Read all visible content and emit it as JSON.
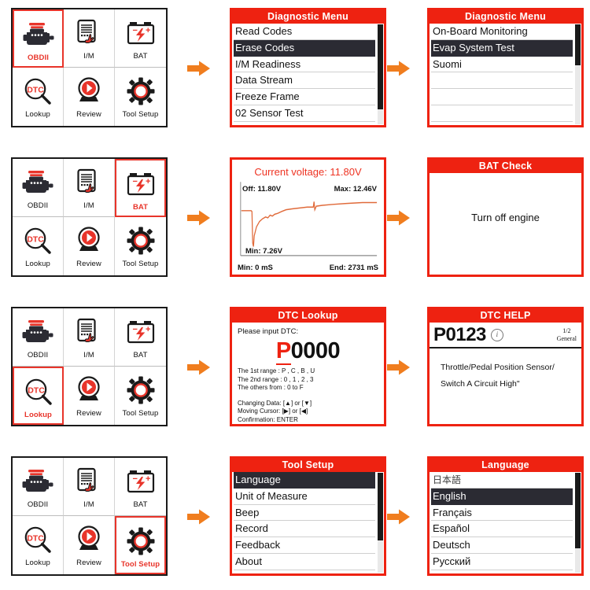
{
  "menu": {
    "items": [
      {
        "label": "OBDII",
        "icon": "engine-icon"
      },
      {
        "label": "I/M",
        "icon": "tablet-hand-icon"
      },
      {
        "label": "BAT",
        "icon": "battery-icon"
      },
      {
        "label": "Lookup",
        "icon": "dtc-magnifier-icon"
      },
      {
        "label": "Review",
        "icon": "play-circle-icon"
      },
      {
        "label": "Tool Setup",
        "icon": "gear-icon"
      }
    ],
    "selected": [
      "OBDII",
      "BAT",
      "Lookup",
      "Tool Setup"
    ]
  },
  "arrow": {
    "icon": "arrow-right-icon",
    "color": "#f07d1e"
  },
  "rows": [
    {
      "mid": {
        "title": "Diagnostic Menu",
        "items": [
          "Read Codes",
          "Erase Codes",
          "I/M Readiness",
          "Data Stream",
          "Freeze Frame",
          "02 Sensor Test"
        ],
        "highlight": 1
      },
      "right": {
        "title": "Diagnostic Menu",
        "items": [
          "On-Board Monitoring",
          "Evap System Test",
          "Suomi",
          "",
          "",
          ""
        ],
        "highlight": 1
      }
    },
    {
      "mid": {
        "title": "Current voltage: 11.80V",
        "off_label": "Off: 11.80V",
        "max_label": "Max: 12.46V",
        "min_label": "Min: 7.26V",
        "foot_left": "Min: 0 mS",
        "foot_right": "End: 2731 mS"
      },
      "right": {
        "title": "BAT Check",
        "message": "Turn off engine"
      }
    },
    {
      "mid": {
        "title": "DTC Lookup",
        "prompt": "Please input DTC:",
        "code_prefix": "P",
        "code_rest": "0000",
        "rules": [
          "The 1st range : P , C , B , U",
          "The 2nd range : 0 , 1 , 2 , 3",
          "The others from : 0 to F"
        ],
        "keys": [
          "Changing Data: [▲]  or [▼]",
          "Moving Cursor:  [▶] or  [◀]",
          "Confirmation:  ENTER"
        ]
      },
      "right": {
        "title": "DTC HELP",
        "code": "P0123",
        "info_icon": "info-icon",
        "page": "1/2",
        "scope": "General",
        "desc_line1": "Throttle/Pedal Position Sensor/",
        "desc_line2": "Switch A Circuit High\""
      }
    },
    {
      "mid": {
        "title": "Tool Setup",
        "items": [
          "Language",
          "Unit of Measure",
          "Beep",
          "Record",
          "Feedback",
          "About"
        ],
        "highlight": 0
      },
      "right": {
        "title": "Language",
        "items": [
          "日本語",
          "English",
          "Français",
          "Español",
          "Deutsch",
          "Русский"
        ],
        "highlight": 1
      }
    }
  ],
  "colors": {
    "accent": "#ee2211",
    "arrow": "#f07d1e",
    "highlight": "#2b2b33"
  }
}
